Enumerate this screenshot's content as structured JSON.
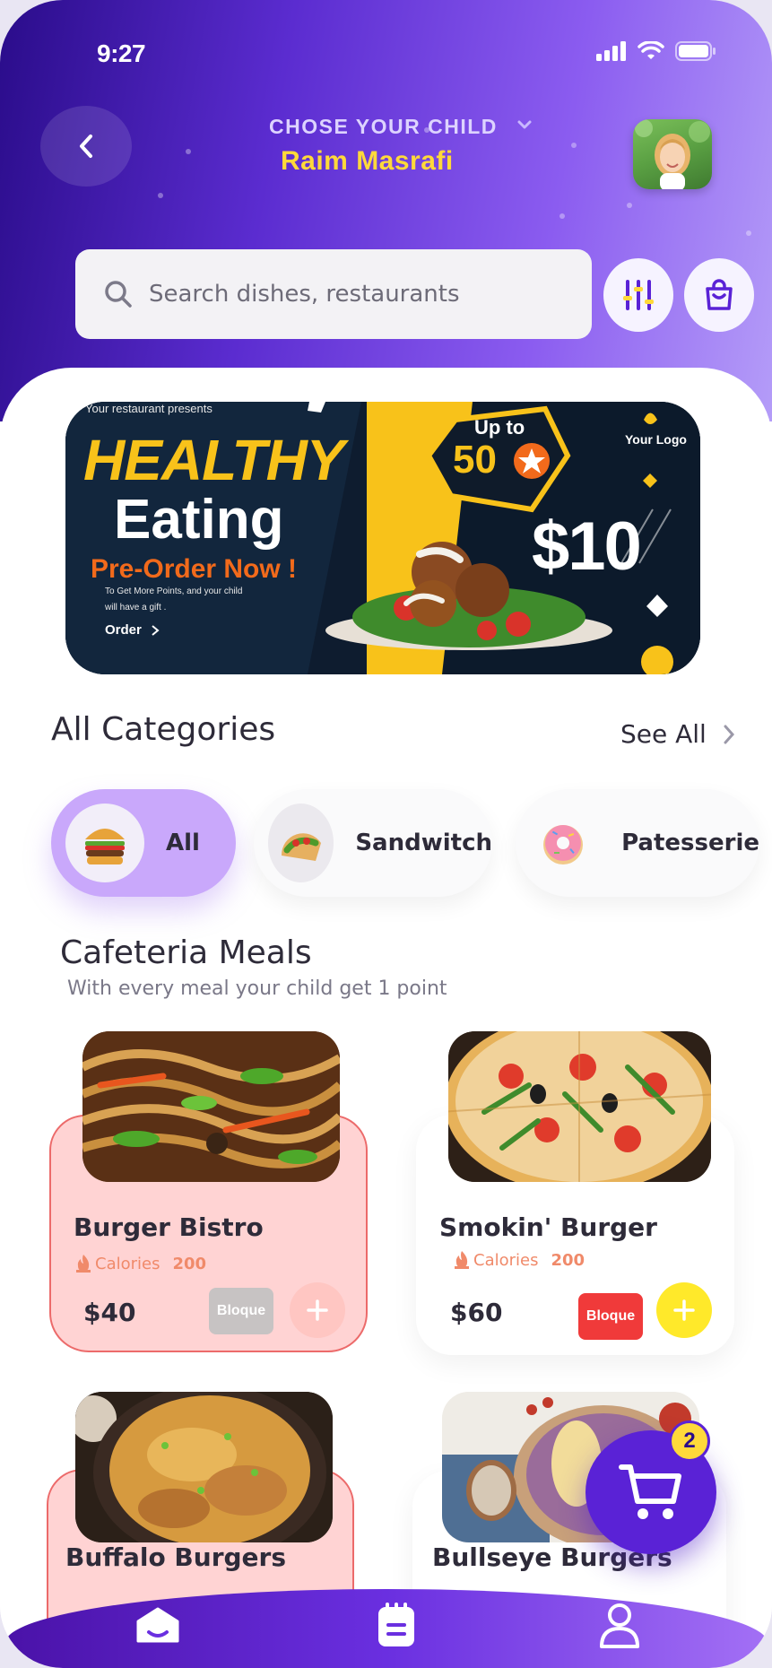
{
  "status_bar": {
    "time": "9:27"
  },
  "header": {
    "chooser_label": "CHOSE YOUR CHILD",
    "child_name": "Raim Masrafi",
    "icons": {
      "back": "chevron-left-icon",
      "chooser": "chevron-down-icon"
    }
  },
  "search": {
    "placeholder": "Search dishes, restaurants"
  },
  "banner": {
    "presenter": "Your restaurant presents",
    "title_line1": "HEALTHY",
    "title_line2": "Eating",
    "cta": "Pre-Order Now !",
    "note_line1": "To Get More Points, and your child",
    "note_line2": "will have a gift .",
    "order_label": "Order",
    "up_to": "Up to",
    "discount": "50",
    "logo_text": "Your Logo",
    "price": "$10"
  },
  "categories": {
    "title": "All Categories",
    "see_all": "See All",
    "items": [
      {
        "label": "All",
        "icon": "burger-icon",
        "active": true
      },
      {
        "label": "Sandwitch",
        "icon": "taco-icon",
        "active": false
      },
      {
        "label": "Patesserie",
        "icon": "donut-icon",
        "active": false
      }
    ]
  },
  "cafeteria": {
    "title": "Cafeteria Meals",
    "subtitle": "With every meal your child get 1 point",
    "meals": [
      {
        "name": "Burger Bistro",
        "calories_label": "Calories",
        "calories": "200",
        "price": "$40",
        "status": "Bloque",
        "image": "noodles"
      },
      {
        "name": "Smokin' Burger",
        "calories_label": "Calories",
        "calories": "200",
        "price": "$60",
        "status": "Bloque",
        "image": "pizza"
      },
      {
        "name": "Buffalo Burgers",
        "image": "biryani"
      },
      {
        "name": "Bullseye Burgers",
        "image": "bowl"
      }
    ]
  },
  "cart": {
    "count": "2"
  },
  "bottom_nav": {
    "items": [
      "home-icon",
      "orders-icon",
      "profile-icon"
    ]
  },
  "colors": {
    "primary": "#5a22d6",
    "accent": "#ffd93a",
    "blocked": "#f03a3a",
    "card_blocked_bg": "#ffd3d3"
  }
}
